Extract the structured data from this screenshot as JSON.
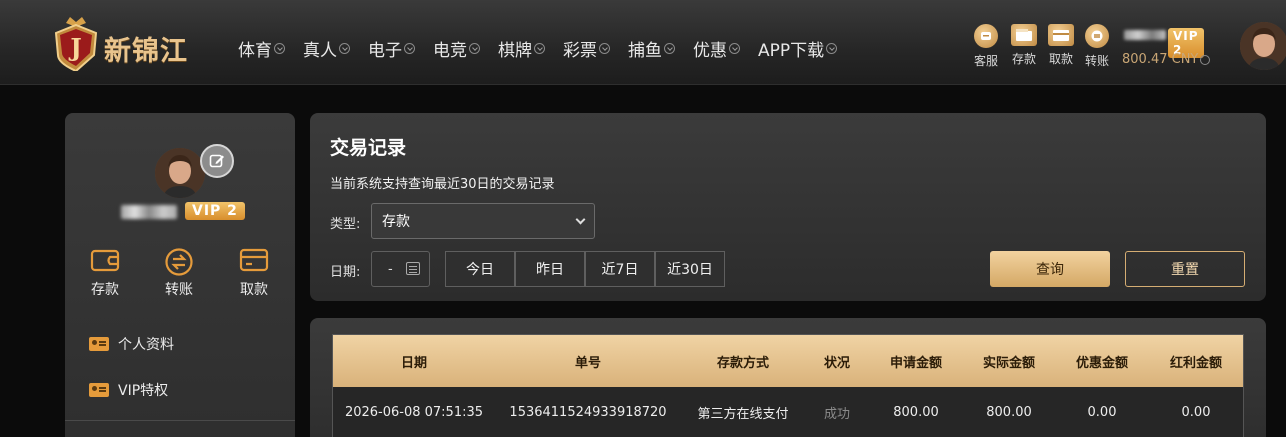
{
  "header": {
    "brand": "新锦江",
    "nav": [
      "体育",
      "真人",
      "电子",
      "电竞",
      "棋牌",
      "彩票",
      "捕鱼",
      "优惠",
      "APP下载"
    ],
    "quick_actions": [
      {
        "label": "客服",
        "icon": "customer-service-icon"
      },
      {
        "label": "存款",
        "icon": "wallet-icon"
      },
      {
        "label": "取款",
        "icon": "card-icon"
      },
      {
        "label": "转账",
        "icon": "transfer-icon"
      }
    ],
    "vip": "VIP 2",
    "balance": "800.47 CNY"
  },
  "sidebar": {
    "vip": "VIP 2",
    "actions": [
      {
        "label": "存款",
        "icon": "wallet-icon"
      },
      {
        "label": "转账",
        "icon": "transfer-icon"
      },
      {
        "label": "取款",
        "icon": "card-icon"
      }
    ],
    "menu": [
      {
        "label": "个人资料",
        "icon": "id-card-icon"
      },
      {
        "label": "VIP特权",
        "icon": "id-card-icon"
      }
    ]
  },
  "query": {
    "title": "交易记录",
    "note": "当前系统支持查询最近30日的交易记录",
    "type_label": "类型:",
    "type_value": "存款",
    "date_label": "日期:",
    "date_value": "-",
    "ranges": [
      "今日",
      "昨日",
      "近7日",
      "近30日"
    ],
    "search_label": "查询",
    "reset_label": "重置"
  },
  "table": {
    "columns": [
      "日期",
      "单号",
      "存款方式",
      "状况",
      "申请金额",
      "实际金额",
      "优惠金额",
      "红利金额"
    ],
    "rows": [
      [
        "2026-06-08 07:51:35",
        "1536411524933918720",
        "第三方在线支付",
        "成功",
        "800.00",
        "800.00",
        "0.00",
        "0.00"
      ]
    ]
  },
  "colors": {
    "accent": "#d9b27a",
    "vip": "#e4a23e",
    "background": "#0b0b0b"
  }
}
